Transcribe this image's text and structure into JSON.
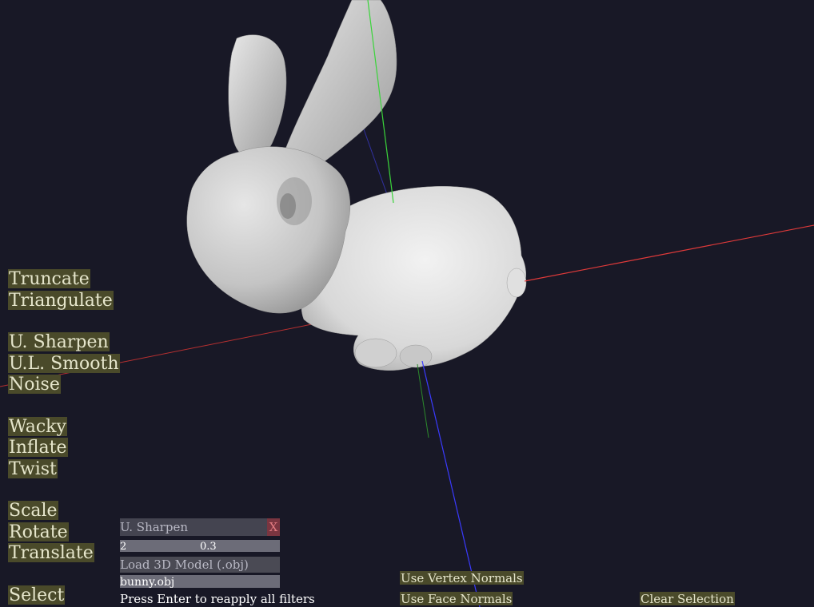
{
  "viewport": {
    "background": "#181826",
    "model_description": "3d-bunny-mesh",
    "axis_colors": {
      "x": "#e03a3a",
      "y": "#3ad43a",
      "z": "#3a3aff"
    }
  },
  "menu": {
    "truncate": "Truncate",
    "triangulate": "Triangulate",
    "sharpen": "U. Sharpen",
    "smooth": "U.L. Smooth",
    "noise": "Noise",
    "wacky": "Wacky",
    "inflate": "Inflate",
    "twist": "Twist",
    "scale": "Scale",
    "rotate": "Rotate",
    "translate": "Translate",
    "select": "Select"
  },
  "panel": {
    "title": "U. Sharpen",
    "close_label": "X",
    "param_a": "2",
    "param_b": "0.3",
    "load_label": "Load 3D Model (.obj)",
    "file_value": "bunny.obj",
    "hint": "Press Enter to reapply all filters"
  },
  "normals": {
    "vertex": "Use Vertex Normals",
    "face": "Use Face Normals"
  },
  "selection": {
    "clear": "Clear Selection"
  }
}
